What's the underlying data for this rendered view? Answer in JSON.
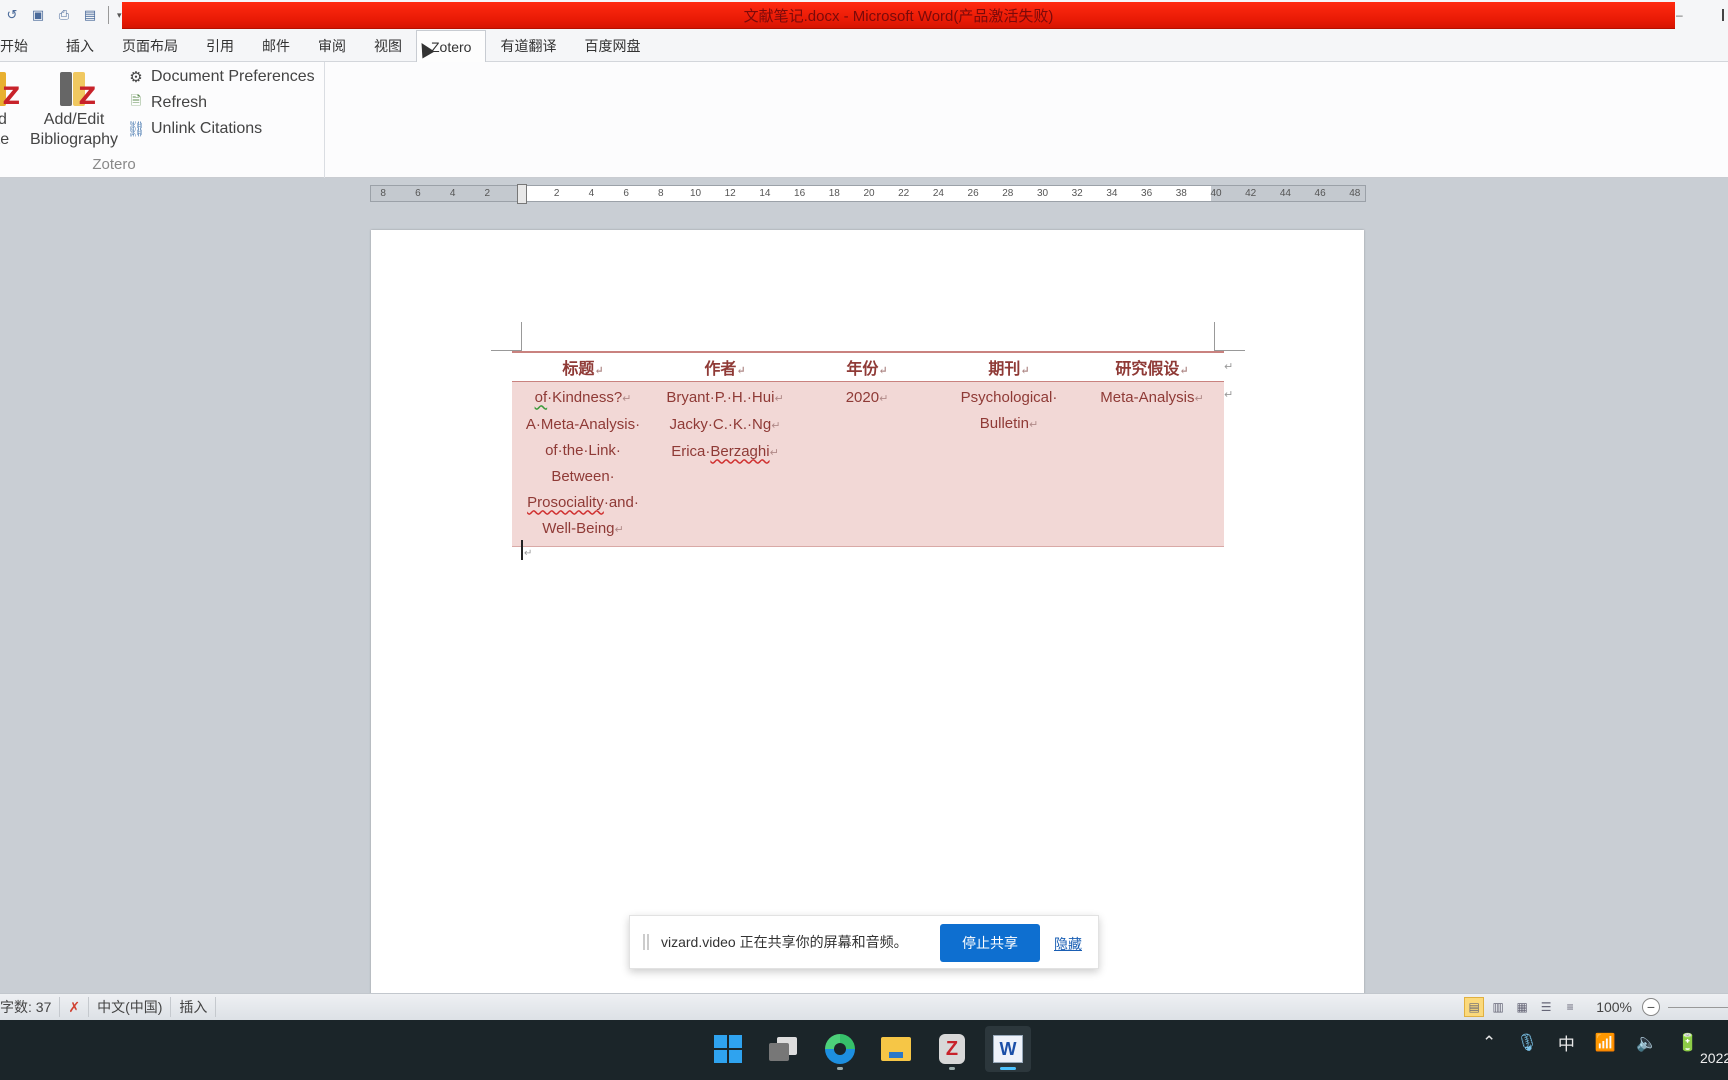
{
  "window": {
    "title": "文献笔记.docx - Microsoft Word(产品激活失败)",
    "title_bar_color": "#e81a05"
  },
  "quick_access": {
    "items": [
      {
        "name": "undo-icon",
        "glyph": "↺"
      },
      {
        "name": "save-icon",
        "glyph": "▣"
      },
      {
        "name": "print-icon",
        "glyph": "⎙"
      },
      {
        "name": "print-preview-icon",
        "glyph": "▤"
      }
    ],
    "dropdown_glyph": "▾"
  },
  "ribbon_tabs": [
    {
      "label": "开始",
      "active": false
    },
    {
      "label": "插入",
      "active": false
    },
    {
      "label": "页面布局",
      "active": false
    },
    {
      "label": "引用",
      "active": false
    },
    {
      "label": "邮件",
      "active": false
    },
    {
      "label": "审阅",
      "active": false
    },
    {
      "label": "视图",
      "active": false
    },
    {
      "label": "Zotero",
      "active": true
    },
    {
      "label": "有道翻译",
      "active": false
    },
    {
      "label": "百度网盘",
      "active": false
    }
  ],
  "zotero_group": {
    "label": "Zotero",
    "add_note": {
      "line1": "Add",
      "line2": "Note",
      "visible1": "dd",
      "visible2": "ote"
    },
    "add_bibliography": {
      "line1": "Add/Edit",
      "line2": "Bibliography"
    },
    "document_preferences": "Document Preferences",
    "refresh": "Refresh",
    "unlink_citations": "Unlink Citations"
  },
  "ruler": {
    "left_ticks": [
      "8",
      "6",
      "4",
      "2"
    ],
    "right_ticks": [
      "2",
      "4",
      "6",
      "8",
      "10",
      "12",
      "14",
      "16",
      "18",
      "20",
      "22",
      "24",
      "26",
      "28",
      "30",
      "32",
      "34",
      "36",
      "38",
      "40",
      "42",
      "44",
      "46",
      "48"
    ]
  },
  "document": {
    "table": {
      "headers": [
        "标题",
        "作者",
        "年份",
        "期刊",
        "研究假设"
      ],
      "row": {
        "title_lines": [
          "of·Kindness?",
          "A·Meta-Analysis·",
          "of·the·Link·",
          "Between·",
          "Prosociality·and·",
          "Well-Being"
        ],
        "author_lines": [
          "Bryant·P.·H.·Hui",
          "Jacky·C.·K.·Ng",
          "Erica·Berzaghi"
        ],
        "year": "2020",
        "journal_lines": [
          "Psychological·",
          "Bulletin"
        ],
        "hypothesis": "Meta-Analysis"
      },
      "header_color": "#8f3a36",
      "cell_bg": "#f2d8d6"
    },
    "pilcrow": "↵"
  },
  "share_bar": {
    "message": "vizard.video 正在共享你的屏幕和音频。",
    "stop_label": "停止共享",
    "hide_label": "隐藏",
    "stop_color": "#0e6fd0"
  },
  "status_bar": {
    "word_count": "字数: 37",
    "language": "中文(中国)",
    "mode": "插入",
    "zoom": "100%"
  },
  "taskbar": {
    "apps": [
      {
        "name": "start",
        "active": false
      },
      {
        "name": "task-view",
        "active": false
      },
      {
        "name": "edge",
        "active": false,
        "running": true
      },
      {
        "name": "file-explorer",
        "active": false
      },
      {
        "name": "zotero",
        "active": false,
        "running": true
      },
      {
        "name": "word",
        "active": true,
        "running": true
      }
    ],
    "tray": {
      "ime": "中",
      "clock_partial": "2022"
    }
  }
}
